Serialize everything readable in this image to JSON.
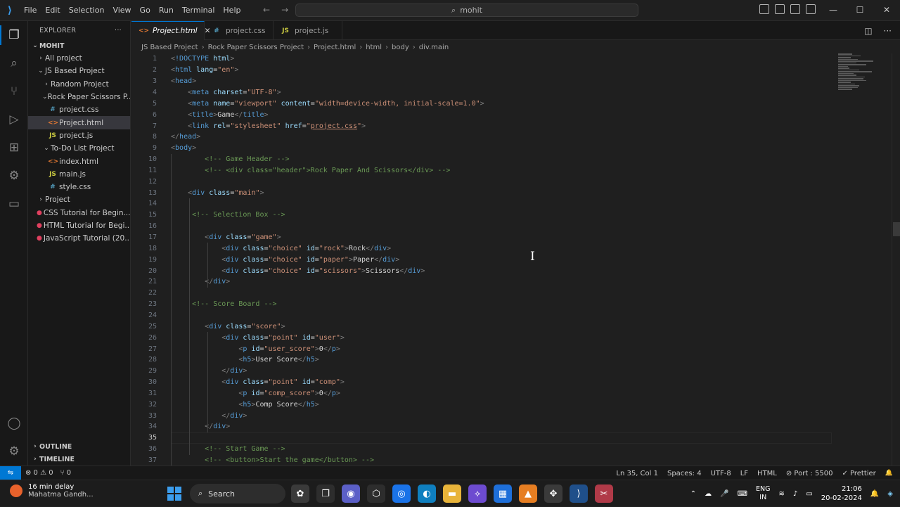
{
  "titlebar": {
    "menu": [
      "File",
      "Edit",
      "Selection",
      "View",
      "Go",
      "Run",
      "Terminal",
      "Help"
    ],
    "command_center": "mohit"
  },
  "sidebar": {
    "header": "EXPLORER",
    "more": "···",
    "root": "MOHIT",
    "tree": [
      {
        "label": "All project",
        "chev": "›",
        "indent": 1,
        "icon": ""
      },
      {
        "label": "JS Based Project",
        "chev": "⌄",
        "indent": 1,
        "icon": ""
      },
      {
        "label": "Random Project",
        "chev": "›",
        "indent": 2,
        "icon": ""
      },
      {
        "label": "Rock Paper Scissors P...",
        "chev": "⌄",
        "indent": 2,
        "icon": ""
      },
      {
        "label": "project.css",
        "chev": "",
        "indent": 3,
        "icon": "css"
      },
      {
        "label": "Project.html",
        "chev": "",
        "indent": 3,
        "icon": "html",
        "selected": true
      },
      {
        "label": "project.js",
        "chev": "",
        "indent": 3,
        "icon": "js"
      },
      {
        "label": "To-Do List Project",
        "chev": "⌄",
        "indent": 2,
        "icon": ""
      },
      {
        "label": "index.html",
        "chev": "",
        "indent": 3,
        "icon": "html"
      },
      {
        "label": "main.js",
        "chev": "",
        "indent": 3,
        "icon": "js"
      },
      {
        "label": "style.css",
        "chev": "",
        "indent": 3,
        "icon": "css"
      },
      {
        "label": "Project",
        "chev": "›",
        "indent": 1,
        "icon": ""
      },
      {
        "label": "CSS Tutorial for Begin...",
        "chev": "",
        "indent": 1,
        "icon": "link"
      },
      {
        "label": "HTML Tutorial for Begi...",
        "chev": "",
        "indent": 1,
        "icon": "link"
      },
      {
        "label": "JavaScript Tutorial (20...",
        "chev": "",
        "indent": 1,
        "icon": "link"
      }
    ],
    "outline": "OUTLINE",
    "timeline": "TIMELINE"
  },
  "tabs": [
    {
      "label": "Project.html",
      "icon": "html",
      "active": true,
      "close": "✕"
    },
    {
      "label": "project.css",
      "icon": "css",
      "active": false
    },
    {
      "label": "project.js",
      "icon": "js",
      "active": false
    }
  ],
  "breadcrumb": [
    "JS Based Project",
    "Rock Paper Scissors Project",
    "Project.html",
    "html",
    "body",
    "div.main"
  ],
  "editor": {
    "current_line": 35,
    "lines": [
      [
        [
          "p",
          "<"
        ],
        [
          "t",
          "!DOCTYPE"
        ],
        [
          "w",
          " "
        ],
        [
          "a",
          "html"
        ],
        [
          "p",
          ">"
        ]
      ],
      [
        [
          "p",
          "<"
        ],
        [
          "t",
          "html"
        ],
        [
          "w",
          " "
        ],
        [
          "a",
          "lang"
        ],
        [
          "w",
          "="
        ],
        [
          "s",
          "\"en\""
        ],
        [
          "p",
          ">"
        ]
      ],
      [
        [
          "p",
          "<"
        ],
        [
          "t",
          "head"
        ],
        [
          "p",
          ">"
        ]
      ],
      [
        [
          "w",
          "    "
        ],
        [
          "p",
          "<"
        ],
        [
          "t",
          "meta"
        ],
        [
          "w",
          " "
        ],
        [
          "a",
          "charset"
        ],
        [
          "w",
          "="
        ],
        [
          "s",
          "\"UTF-8\""
        ],
        [
          "p",
          ">"
        ]
      ],
      [
        [
          "w",
          "    "
        ],
        [
          "p",
          "<"
        ],
        [
          "t",
          "meta"
        ],
        [
          "w",
          " "
        ],
        [
          "a",
          "name"
        ],
        [
          "w",
          "="
        ],
        [
          "s",
          "\"viewport\""
        ],
        [
          "w",
          " "
        ],
        [
          "a",
          "content"
        ],
        [
          "w",
          "="
        ],
        [
          "s",
          "\"width=device-width, initial-scale=1.0\""
        ],
        [
          "p",
          ">"
        ]
      ],
      [
        [
          "w",
          "    "
        ],
        [
          "p",
          "<"
        ],
        [
          "t",
          "title"
        ],
        [
          "p",
          ">"
        ],
        [
          "w",
          "Game"
        ],
        [
          "p",
          "</"
        ],
        [
          "t",
          "title"
        ],
        [
          "p",
          ">"
        ]
      ],
      [
        [
          "w",
          "    "
        ],
        [
          "p",
          "<"
        ],
        [
          "t",
          "link"
        ],
        [
          "w",
          " "
        ],
        [
          "a",
          "rel"
        ],
        [
          "w",
          "="
        ],
        [
          "s",
          "\"stylesheet\""
        ],
        [
          "w",
          " "
        ],
        [
          "a",
          "href"
        ],
        [
          "w",
          "="
        ],
        [
          "s",
          "\""
        ],
        [
          "u",
          "project.css"
        ],
        [
          "s",
          "\""
        ],
        [
          "p",
          ">"
        ]
      ],
      [
        [
          "p",
          "</"
        ],
        [
          "t",
          "head"
        ],
        [
          "p",
          ">"
        ]
      ],
      [
        [
          "p",
          "<"
        ],
        [
          "t",
          "body"
        ],
        [
          "p",
          ">"
        ]
      ],
      [
        [
          "w",
          "        "
        ],
        [
          "c",
          "<!-- Game Header -->"
        ]
      ],
      [
        [
          "w",
          "        "
        ],
        [
          "c",
          "<!-- <div class=\"header\">Rock Paper And Scissors</div> -->"
        ]
      ],
      [],
      [
        [
          "w",
          "    "
        ],
        [
          "p",
          "<"
        ],
        [
          "t",
          "div"
        ],
        [
          "w",
          " "
        ],
        [
          "a",
          "class"
        ],
        [
          "w",
          "="
        ],
        [
          "s",
          "\"main\""
        ],
        [
          "p",
          ">"
        ]
      ],
      [],
      [
        [
          "w",
          "     "
        ],
        [
          "c",
          "<!-- Selection Box -->"
        ]
      ],
      [],
      [
        [
          "w",
          "        "
        ],
        [
          "p",
          "<"
        ],
        [
          "t",
          "div"
        ],
        [
          "w",
          " "
        ],
        [
          "a",
          "class"
        ],
        [
          "w",
          "="
        ],
        [
          "s",
          "\"game\""
        ],
        [
          "p",
          ">"
        ]
      ],
      [
        [
          "w",
          "            "
        ],
        [
          "p",
          "<"
        ],
        [
          "t",
          "div"
        ],
        [
          "w",
          " "
        ],
        [
          "a",
          "class"
        ],
        [
          "w",
          "="
        ],
        [
          "s",
          "\"choice\""
        ],
        [
          "w",
          " "
        ],
        [
          "a",
          "id"
        ],
        [
          "w",
          "="
        ],
        [
          "s",
          "\"rock\""
        ],
        [
          "p",
          ">"
        ],
        [
          "w",
          "Rock"
        ],
        [
          "p",
          "</"
        ],
        [
          "t",
          "div"
        ],
        [
          "p",
          ">"
        ]
      ],
      [
        [
          "w",
          "            "
        ],
        [
          "p",
          "<"
        ],
        [
          "t",
          "div"
        ],
        [
          "w",
          " "
        ],
        [
          "a",
          "class"
        ],
        [
          "w",
          "="
        ],
        [
          "s",
          "\"choice\""
        ],
        [
          "w",
          " "
        ],
        [
          "a",
          "id"
        ],
        [
          "w",
          "="
        ],
        [
          "s",
          "\"paper\""
        ],
        [
          "p",
          ">"
        ],
        [
          "w",
          "Paper"
        ],
        [
          "p",
          "</"
        ],
        [
          "t",
          "div"
        ],
        [
          "p",
          ">"
        ]
      ],
      [
        [
          "w",
          "            "
        ],
        [
          "p",
          "<"
        ],
        [
          "t",
          "div"
        ],
        [
          "w",
          " "
        ],
        [
          "a",
          "class"
        ],
        [
          "w",
          "="
        ],
        [
          "s",
          "\"choice\""
        ],
        [
          "w",
          " "
        ],
        [
          "a",
          "id"
        ],
        [
          "w",
          "="
        ],
        [
          "s",
          "\"scissors\""
        ],
        [
          "p",
          ">"
        ],
        [
          "w",
          "Scissors"
        ],
        [
          "p",
          "</"
        ],
        [
          "t",
          "div"
        ],
        [
          "p",
          ">"
        ]
      ],
      [
        [
          "w",
          "        "
        ],
        [
          "p",
          "</"
        ],
        [
          "t",
          "div"
        ],
        [
          "p",
          ">"
        ]
      ],
      [],
      [
        [
          "w",
          "     "
        ],
        [
          "c",
          "<!-- Score Board -->"
        ]
      ],
      [],
      [
        [
          "w",
          "        "
        ],
        [
          "p",
          "<"
        ],
        [
          "t",
          "div"
        ],
        [
          "w",
          " "
        ],
        [
          "a",
          "class"
        ],
        [
          "w",
          "="
        ],
        [
          "s",
          "\"score\""
        ],
        [
          "p",
          ">"
        ]
      ],
      [
        [
          "w",
          "            "
        ],
        [
          "p",
          "<"
        ],
        [
          "t",
          "div"
        ],
        [
          "w",
          " "
        ],
        [
          "a",
          "class"
        ],
        [
          "w",
          "="
        ],
        [
          "s",
          "\"point\""
        ],
        [
          "w",
          " "
        ],
        [
          "a",
          "id"
        ],
        [
          "w",
          "="
        ],
        [
          "s",
          "\"user\""
        ],
        [
          "p",
          ">"
        ]
      ],
      [
        [
          "w",
          "                "
        ],
        [
          "p",
          "<"
        ],
        [
          "t",
          "p"
        ],
        [
          "w",
          " "
        ],
        [
          "a",
          "id"
        ],
        [
          "w",
          "="
        ],
        [
          "s",
          "\"user_score\""
        ],
        [
          "p",
          ">"
        ],
        [
          "w",
          "0"
        ],
        [
          "p",
          "</"
        ],
        [
          "t",
          "p"
        ],
        [
          "p",
          ">"
        ]
      ],
      [
        [
          "w",
          "                "
        ],
        [
          "p",
          "<"
        ],
        [
          "t",
          "h5"
        ],
        [
          "p",
          ">"
        ],
        [
          "w",
          "User Score"
        ],
        [
          "p",
          "</"
        ],
        [
          "t",
          "h5"
        ],
        [
          "p",
          ">"
        ]
      ],
      [
        [
          "w",
          "            "
        ],
        [
          "p",
          "</"
        ],
        [
          "t",
          "div"
        ],
        [
          "p",
          ">"
        ]
      ],
      [
        [
          "w",
          "            "
        ],
        [
          "p",
          "<"
        ],
        [
          "t",
          "div"
        ],
        [
          "w",
          " "
        ],
        [
          "a",
          "class"
        ],
        [
          "w",
          "="
        ],
        [
          "s",
          "\"point\""
        ],
        [
          "w",
          " "
        ],
        [
          "a",
          "id"
        ],
        [
          "w",
          "="
        ],
        [
          "s",
          "\"comp\""
        ],
        [
          "p",
          ">"
        ]
      ],
      [
        [
          "w",
          "                "
        ],
        [
          "p",
          "<"
        ],
        [
          "t",
          "p"
        ],
        [
          "w",
          " "
        ],
        [
          "a",
          "id"
        ],
        [
          "w",
          "="
        ],
        [
          "s",
          "\"comp_score\""
        ],
        [
          "p",
          ">"
        ],
        [
          "w",
          "0"
        ],
        [
          "p",
          "</"
        ],
        [
          "t",
          "p"
        ],
        [
          "p",
          ">"
        ]
      ],
      [
        [
          "w",
          "                "
        ],
        [
          "p",
          "<"
        ],
        [
          "t",
          "h5"
        ],
        [
          "p",
          ">"
        ],
        [
          "w",
          "Comp Score"
        ],
        [
          "p",
          "</"
        ],
        [
          "t",
          "h5"
        ],
        [
          "p",
          ">"
        ]
      ],
      [
        [
          "w",
          "            "
        ],
        [
          "p",
          "</"
        ],
        [
          "t",
          "div"
        ],
        [
          "p",
          ">"
        ]
      ],
      [
        [
          "w",
          "        "
        ],
        [
          "p",
          "</"
        ],
        [
          "t",
          "div"
        ],
        [
          "p",
          ">"
        ]
      ],
      [],
      [
        [
          "w",
          "        "
        ],
        [
          "c",
          "<!-- Start Game -->"
        ]
      ],
      [
        [
          "w",
          "        "
        ],
        [
          "c",
          "<!-- <button>Start the game</button> -->"
        ]
      ]
    ]
  },
  "statusbar": {
    "remote": "⇋",
    "errors": "⊗ 0 ⚠ 0",
    "ports": "⑂ 0",
    "position": "Ln 35, Col 1",
    "spaces": "Spaces: 4",
    "encoding": "UTF-8",
    "eol": "LF",
    "language": "HTML",
    "port": "⊘ Port : 5500",
    "prettier": "✓ Prettier",
    "bell": "🔔"
  },
  "taskbar": {
    "weather_line1": "16 min delay",
    "weather_line2": "Mahatma Gandh...",
    "search": "Search",
    "lang_line1": "ENG",
    "lang_line2": "IN",
    "time": "21:06",
    "date": "20-02-2024"
  }
}
